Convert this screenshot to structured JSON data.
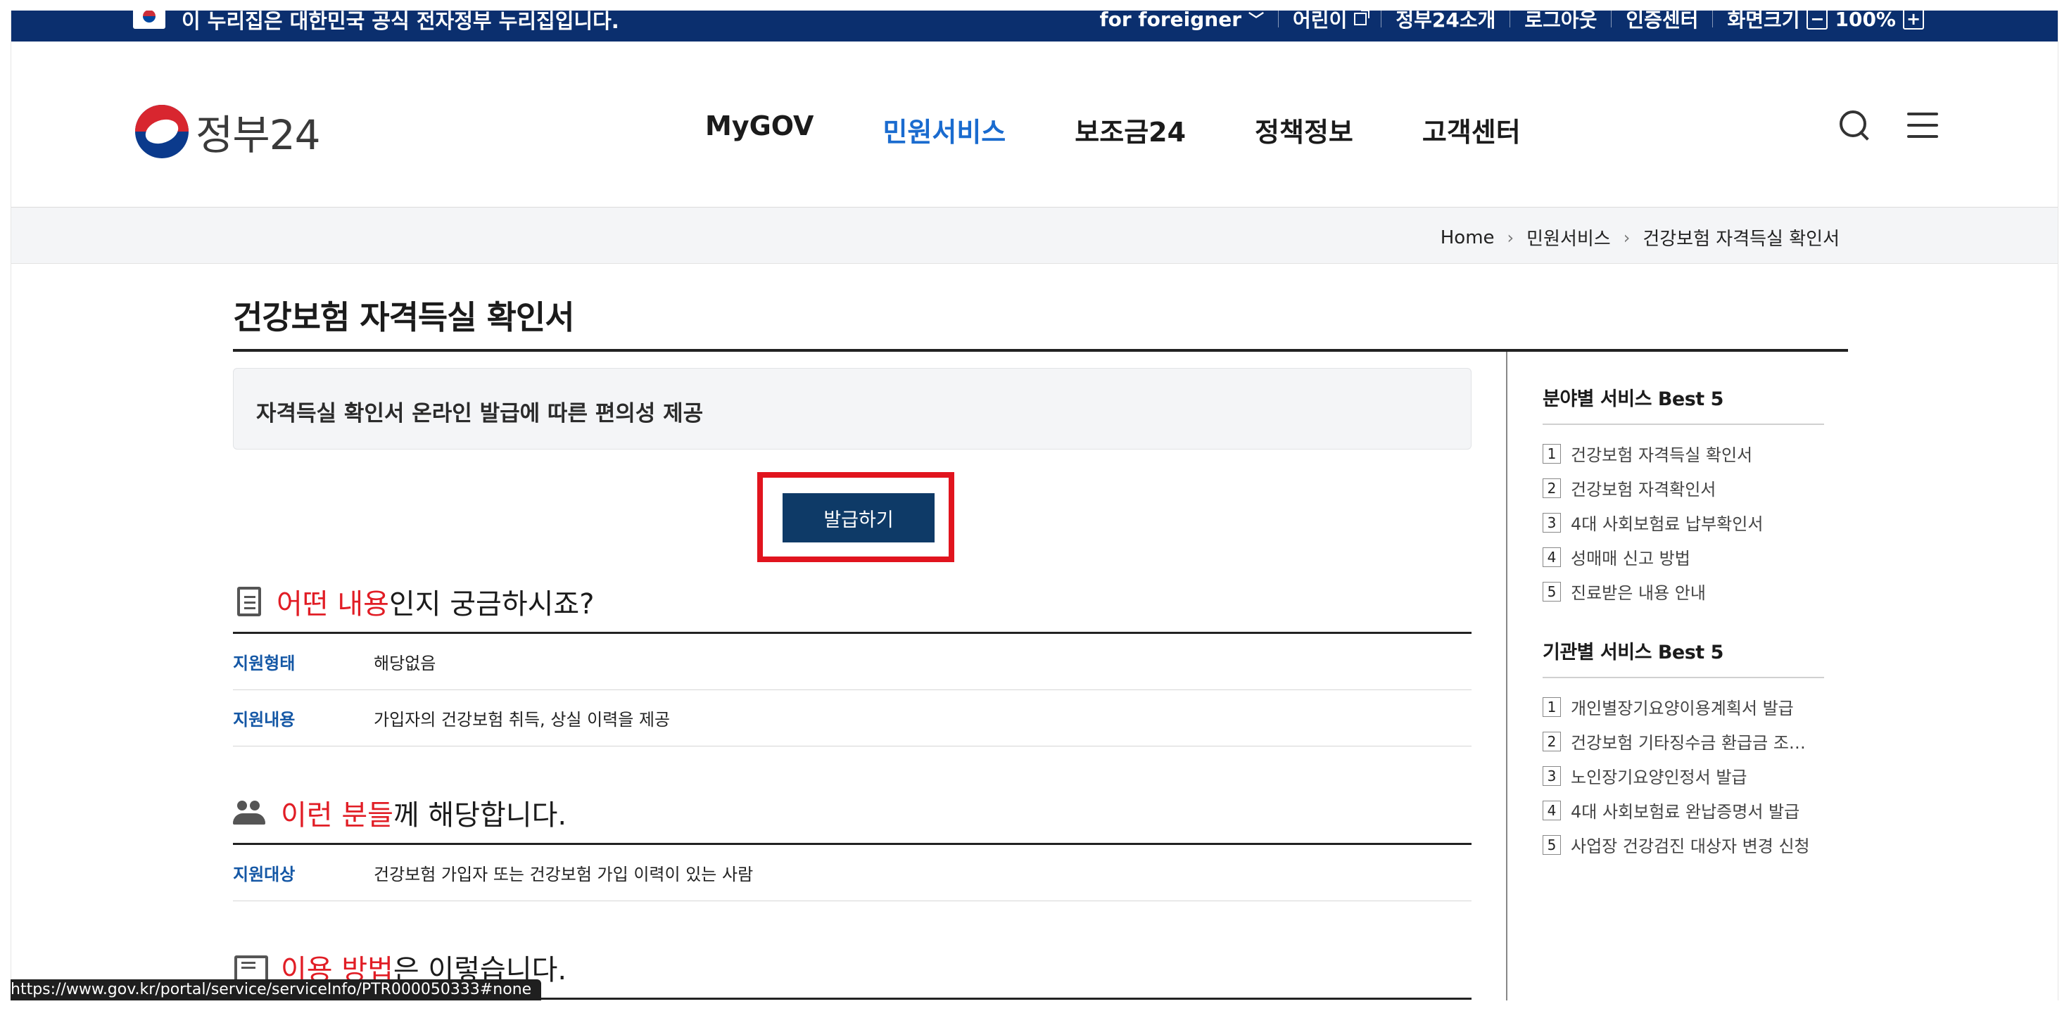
{
  "topbar": {
    "notice": "이 누리집은 대한민국 공식 전자정부 누리집입니다.",
    "foreigner": "for foreigner",
    "kids": "어린이",
    "intro": "정부24소개",
    "logout": "로그아웃",
    "cert": "인증센터",
    "zoom_label": "화면크기",
    "zoom_minus": "−",
    "zoom_value": "100%",
    "zoom_plus": "+"
  },
  "header": {
    "logo_text": "정부24",
    "gnb": [
      "MyGOV",
      "민원서비스",
      "보조금24",
      "정책정보",
      "고객센터"
    ],
    "active_menu": "민원서비스"
  },
  "breadcrumb": [
    "Home",
    "민원서비스",
    "건강보험 자격득실 확인서"
  ],
  "page": {
    "title": "건강보험 자격득실 확인서",
    "summary": "자격득실 확인서 온라인 발급에 따른 편의성 제공",
    "issue_button": "발급하기"
  },
  "sections": {
    "what": {
      "head_red": "어떤 내용",
      "head_rest": "인지 궁금하시죠?",
      "rows": [
        {
          "k": "지원형태",
          "v": "해당없음"
        },
        {
          "k": "지원내용",
          "v": "가입자의 건강보험 취득, 상실 이력을 제공"
        }
      ]
    },
    "who": {
      "head_red": "이런 분들",
      "head_rest": "께 해당합니다.",
      "rows": [
        {
          "k": "지원대상",
          "v": "건강보험 가입자 또는 건강보험 가입 이력이 있는 사람"
        }
      ]
    },
    "how": {
      "head_red": "이용 방법",
      "head_rest": "은 이렇습니다."
    }
  },
  "sidebar": {
    "field_title": "분야별 서비스 Best 5",
    "field_items": [
      "건강보험 자격득실 확인서",
      "건강보험 자격확인서",
      "4대 사회보험료 납부확인서",
      "성매매 신고 방법",
      "진료받은 내용 안내"
    ],
    "agency_title": "기관별 서비스 Best 5",
    "agency_items": [
      "개인별장기요양이용계획서 발급",
      "건강보험 기타징수금 환급금 조…",
      "노인장기요양인정서 발급",
      "4대 사회보험료 완납증명서 발급",
      "사업장 건강검진 대상자 변경 신청"
    ],
    "numbers": [
      "1",
      "2",
      "3",
      "4",
      "5"
    ]
  },
  "status_url": "https://www.gov.kr/portal/service/serviceInfo/PTR000050333#none",
  "colors": {
    "topbar_bg": "#0b2f6e",
    "active_menu": "#1a6bcf",
    "issue_button_bg": "#0e3a67",
    "highlight_box": "#e1141e",
    "heading_red": "#e11d25",
    "row_key": "#1457a5"
  }
}
